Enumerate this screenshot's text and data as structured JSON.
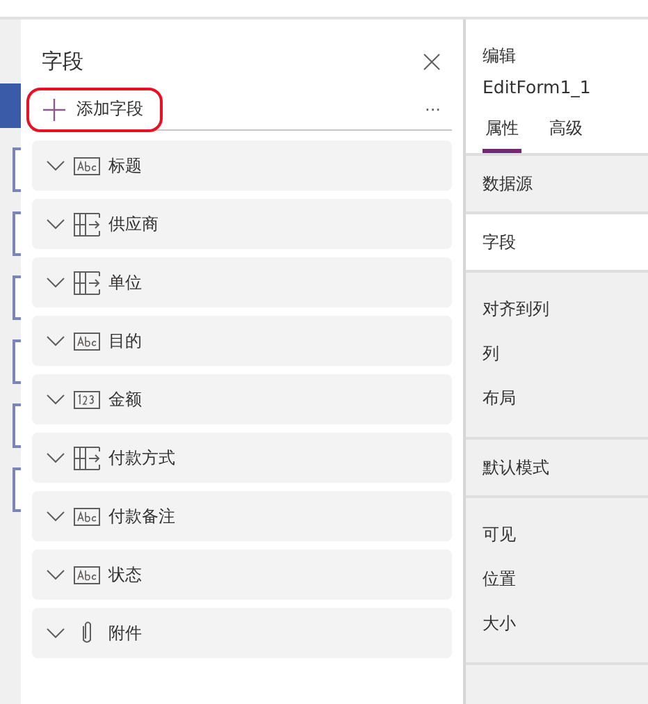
{
  "fields_panel": {
    "title": "字段",
    "add_button": {
      "label": "添加字段",
      "highlighted": true
    },
    "more": "···",
    "fields": [
      {
        "label": "标题",
        "kind": "text",
        "expanded": false
      },
      {
        "label": "供应商",
        "kind": "lookup",
        "expanded": false
      },
      {
        "label": "单位",
        "kind": "lookup",
        "expanded": false
      },
      {
        "label": "目的",
        "kind": "text",
        "expanded": false
      },
      {
        "label": "金额",
        "kind": "number",
        "expanded": false
      },
      {
        "label": "付款方式",
        "kind": "lookup",
        "expanded": false
      },
      {
        "label": "付款备注",
        "kind": "text",
        "expanded": false
      },
      {
        "label": "状态",
        "kind": "text",
        "expanded": false
      },
      {
        "label": "附件",
        "kind": "attachment",
        "expanded": false
      }
    ]
  },
  "properties_pane": {
    "caption": "编辑",
    "control_name": "EditForm1_1",
    "tabs": [
      {
        "label": "属性",
        "selected": true
      },
      {
        "label": "高级",
        "selected": false
      }
    ],
    "sections": [
      {
        "rows": [
          {
            "label": "数据源",
            "selected": false
          }
        ]
      },
      {
        "rows": [
          {
            "label": "字段",
            "selected": true
          }
        ]
      },
      {
        "rows": [
          {
            "label": "对齐到列",
            "selected": false
          },
          {
            "label": "列",
            "selected": false
          },
          {
            "label": "布局",
            "selected": false
          }
        ]
      },
      {
        "rows": [
          {
            "label": "默认模式",
            "selected": false
          }
        ]
      },
      {
        "rows": [
          {
            "label": "可见",
            "selected": false
          },
          {
            "label": "位置",
            "selected": false
          },
          {
            "label": "大小",
            "selected": false
          }
        ]
      }
    ]
  }
}
